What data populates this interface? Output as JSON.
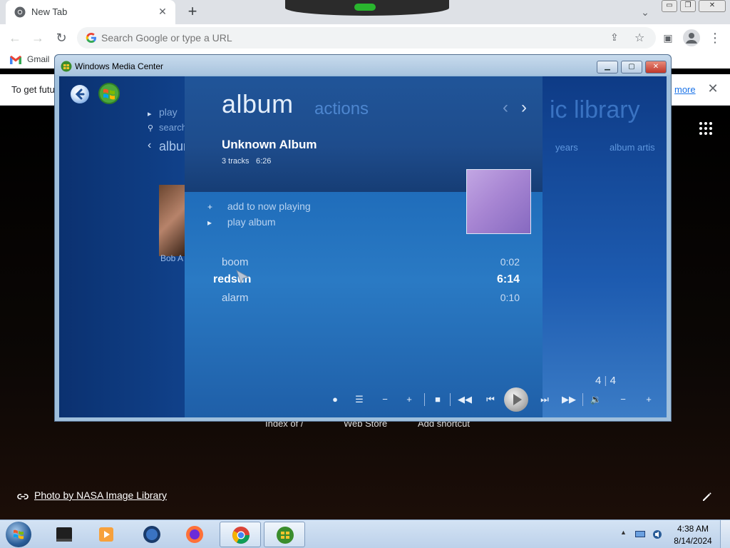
{
  "browser": {
    "tab": {
      "title": "New Tab"
    },
    "omnibox": {
      "placeholder": "Search Google or type a URL"
    },
    "bookmarks": [
      {
        "label": "Gmail"
      }
    ],
    "infobar": {
      "text": "To get futu",
      "link": "more"
    }
  },
  "ntp": {
    "shortcuts": [
      "Index of /",
      "Web Store",
      "Add shortcut"
    ],
    "photo_credit": "Photo by NASA Image Library"
  },
  "wmc": {
    "window_title": "Windows Media Center",
    "background": {
      "left_menu": [
        "play",
        "search",
        "album"
      ],
      "thumb_label": "Bob A",
      "heading": "ic library",
      "tabs": [
        "years",
        "album artis"
      ]
    },
    "panel": {
      "heading": "album",
      "tab": "actions",
      "album_title": "Unknown Album",
      "tracks_count": "3 tracks",
      "total_time": "6:26",
      "actions": [
        {
          "icon": "+",
          "label": "add to now playing"
        },
        {
          "icon": "▸",
          "label": "play album"
        }
      ],
      "tracks": [
        {
          "name": "boom",
          "time": "0:02"
        },
        {
          "name": "redsun",
          "time": "6:14"
        },
        {
          "name": "alarm",
          "time": "0:10"
        }
      ]
    },
    "page": {
      "current": "4",
      "total": "4"
    }
  },
  "taskbar": {
    "time": "4:38 AM",
    "date": "8/14/2024"
  }
}
